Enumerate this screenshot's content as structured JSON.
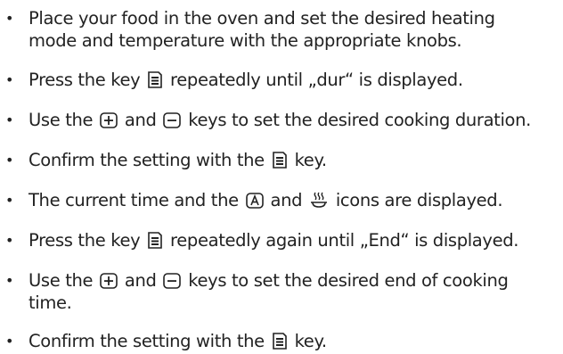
{
  "instructions": {
    "steps": [
      {
        "line1": "Place your food in the oven and set the desired heating",
        "line2": "mode and temperature with the appropriate knobs."
      },
      {
        "before": "Press the key",
        "icon": "menu-key-icon",
        "after": "repeatedly until „dur“ is displayed."
      },
      {
        "before": "Use the",
        "icon1": "plus-key-icon",
        "middle": "and",
        "icon2": "minus-key-icon",
        "after": "keys to set the desired cooking duration."
      },
      {
        "before": "Confirm the setting with the",
        "icon": "menu-key-icon",
        "after": "key."
      },
      {
        "before": "The current time and the",
        "icon1": "automatic-a-icon",
        "middle": "and",
        "icon2": "cooking-pot-icon",
        "after": "icons are displayed."
      },
      {
        "before": "Press the key",
        "icon": "menu-key-icon",
        "after": "repeatedly again until „End“ is displayed."
      },
      {
        "before": "Use the",
        "icon1": "plus-key-icon",
        "middle": "and",
        "icon2": "minus-key-icon",
        "after": "keys to set the desired end of cooking",
        "line2": "time."
      },
      {
        "before": "Confirm the setting with the",
        "icon": "menu-key-icon",
        "after": "key."
      }
    ]
  }
}
